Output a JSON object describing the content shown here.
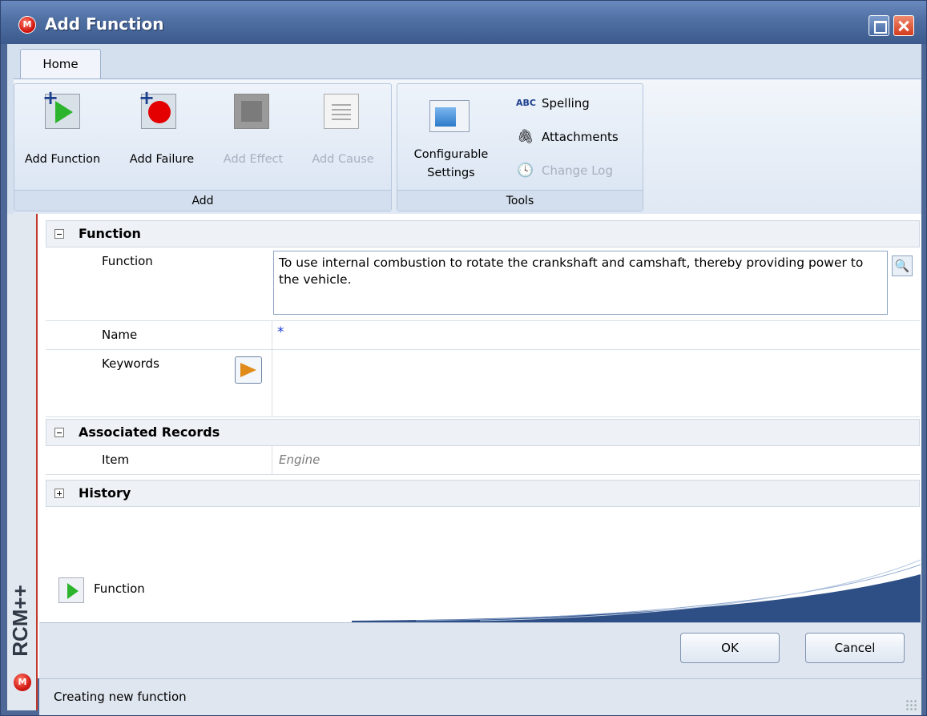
{
  "window": {
    "title": "Add Function",
    "logo": "M"
  },
  "ribbon": {
    "tab": "Home",
    "groups": {
      "add": {
        "label": "Add",
        "buttons": {
          "add_function": "Add Function",
          "add_failure": "Add Failure",
          "add_effect": "Add Effect",
          "add_cause": "Add Cause"
        }
      },
      "tools": {
        "label": "Tools",
        "configurable_settings_line1": "Configurable",
        "configurable_settings_line2": "Settings",
        "spelling": "Spelling",
        "attachments": "Attachments",
        "change_log": "Change Log",
        "spelling_icon": "ABC"
      }
    }
  },
  "form": {
    "function_section": {
      "header": "Function",
      "function_label": "Function",
      "function_value": "To use internal combustion to rotate the crankshaft and camshaft, thereby providing power to the vehicle.",
      "name_label": "Name",
      "name_required_marker": "*",
      "keywords_label": "Keywords"
    },
    "associated_section": {
      "header": "Associated Records",
      "item_label": "Item",
      "item_value": "Engine"
    },
    "history_section": {
      "header": "History"
    }
  },
  "legend": {
    "label": "Function"
  },
  "side": {
    "brand": "RCM++",
    "logo": "M"
  },
  "footer": {
    "ok": "OK",
    "cancel": "Cancel"
  },
  "status": {
    "text": "Creating new function"
  },
  "colors": {
    "title_bar": "#4f6fa3",
    "accent_red": "#c0392b",
    "function_green": "#2cb52c",
    "failure_red": "#e40000"
  }
}
